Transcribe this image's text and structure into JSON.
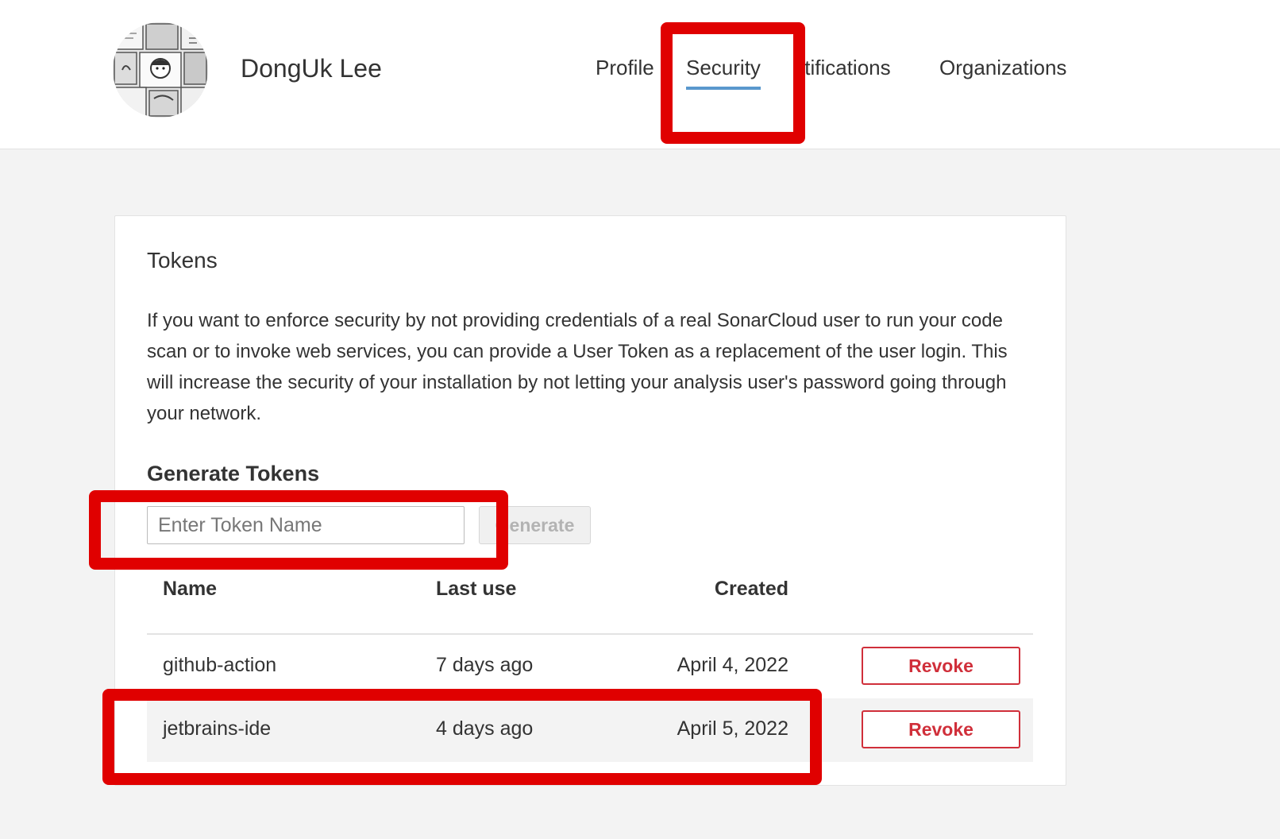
{
  "header": {
    "user_name": "DongUk Lee",
    "tabs": [
      {
        "label": "Profile",
        "active": false
      },
      {
        "label": "Security",
        "active": true
      },
      {
        "label": "Notifications",
        "active": false
      },
      {
        "label": "Organizations",
        "active": false
      }
    ],
    "notifications_visible_text": "lotifications"
  },
  "tokens": {
    "title": "Tokens",
    "description": "If you want to enforce security by not providing credentials of a real SonarCloud user to run your code scan or to invoke web services, you can provide a User Token as a replacement of the user login. This will increase the security of your installation by not letting your analysis user's password going through your network.",
    "generate_heading": "Generate Tokens",
    "input_placeholder": "Enter Token Name",
    "input_value": "",
    "generate_button_label": "Generate",
    "table": {
      "columns": [
        "Name",
        "Last use",
        "Created"
      ],
      "rows": [
        {
          "name": "github-action",
          "last_use": "7 days ago",
          "created": "April 4, 2022",
          "action": "Revoke"
        },
        {
          "name": "jetbrains-ide",
          "last_use": "4 days ago",
          "created": "April 5, 2022",
          "action": "Revoke"
        }
      ]
    }
  },
  "colors": {
    "accent_underline": "#5a98cd",
    "revoke": "#d02f3a",
    "highlight": "#e00000"
  },
  "icons": {
    "avatar": "user-avatar-manga-image"
  }
}
